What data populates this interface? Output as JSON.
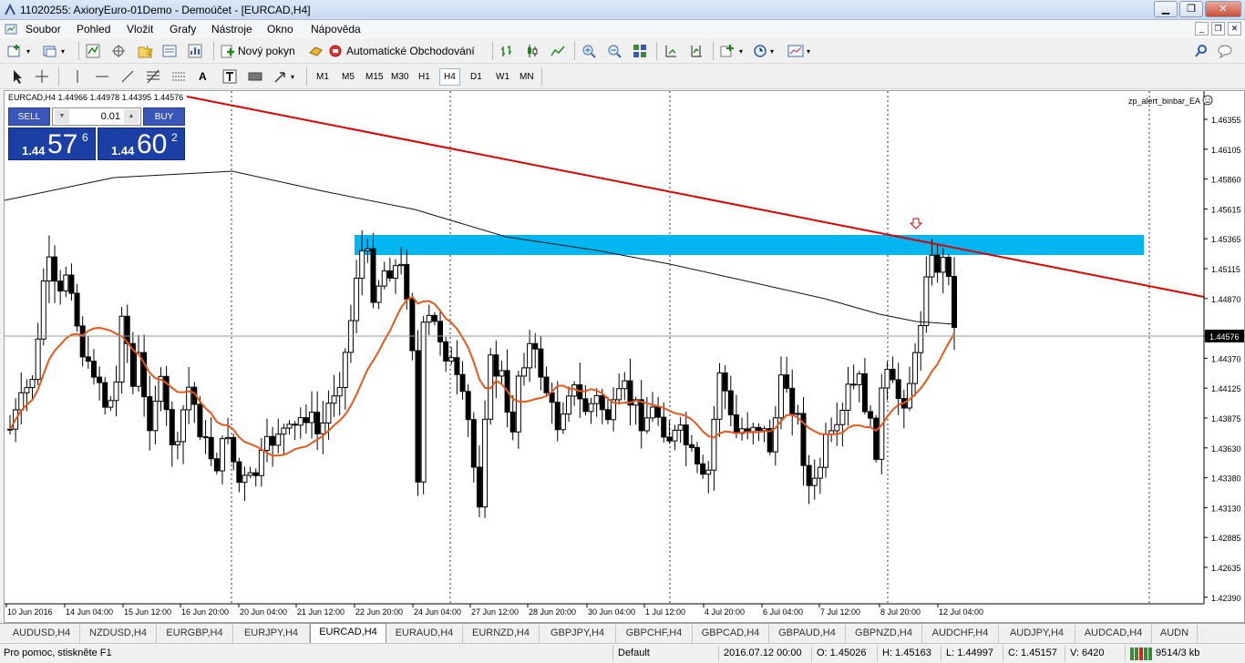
{
  "window": {
    "title": "11020255: AxioryEuro-01Demo - Demoúčet - [EURCAD,H4]"
  },
  "menu": [
    "Soubor",
    "Pohled",
    "Vložit",
    "Grafy",
    "Nástroje",
    "Okno",
    "Nápověda"
  ],
  "toolbar": {
    "new_order": "Nový pokyn",
    "auto_trading": "Automatické Obchodování"
  },
  "timeframes": [
    "M1",
    "M5",
    "M15",
    "M30",
    "H1",
    "H4",
    "D1",
    "W1",
    "MN"
  ],
  "active_timeframe": "H4",
  "chart": {
    "info": "EURCAD,H4  1.44966 1.44978 1.44395 1.44576",
    "ea_label": "zp_alert_binbar_EA",
    "current_price": "1.44576",
    "y_ticks": [
      "1.46355",
      "1.46105",
      "1.45860",
      "1.45615",
      "1.45365",
      "1.45115",
      "1.44870",
      "1.44576",
      "1.44370",
      "1.44125",
      "1.43875",
      "1.43630",
      "1.43380",
      "1.43130",
      "1.42885",
      "1.42635",
      "1.42390"
    ],
    "x_ticks": [
      "10 Jun 2016",
      "14 Jun 04:00",
      "15 Jun 12:00",
      "16 Jun 20:00",
      "20 Jun 04:00",
      "21 Jun 12:00",
      "22 Jun 20:00",
      "24 Jun 04:00",
      "27 Jun 12:00",
      "28 Jun 20:00",
      "30 Jun 04:00",
      "1 Jul 12:00",
      "4 Jul 20:00",
      "6 Jul 04:00",
      "7 Jul 12:00",
      "8 Jul 20:00",
      "12 Jul 04:00"
    ],
    "colors": {
      "trendline": "#e00000",
      "fast_ma": "#e8581a",
      "slow_ma": "#111111",
      "zone": "#00b6f0",
      "bull": "#ffffff",
      "bear": "#000000"
    }
  },
  "trade_panel": {
    "sell": "SELL",
    "buy": "BUY",
    "lot": "0.01",
    "bid_small": "1.44",
    "bid_big": "57",
    "bid_sup": "6",
    "ask_small": "1.44",
    "ask_big": "60",
    "ask_sup": "2"
  },
  "tabs": [
    "AUDUSD,H4",
    "NZDUSD,H4",
    "EURGBP,H4",
    "EURJPY,H4",
    "EURCAD,H4",
    "EURAUD,H4",
    "EURNZD,H4",
    "GBPJPY,H4",
    "GBPCHF,H4",
    "GBPCAD,H4",
    "GBPAUD,H4",
    "GBPNZD,H4",
    "AUDCHF,H4",
    "AUDJPY,H4",
    "AUDCAD,H4",
    "AUDN"
  ],
  "active_tab": "EURCAD,H4",
  "status": {
    "help": "Pro pomoc, stiskněte F1",
    "profile": "Default",
    "time": "2016.07.12 00:00",
    "open": "O: 1.45026",
    "high": "H: 1.45163",
    "low": "L: 1.44997",
    "close": "C: 1.45157",
    "volume": "V: 6420",
    "traffic": "9514/3 kb"
  }
}
